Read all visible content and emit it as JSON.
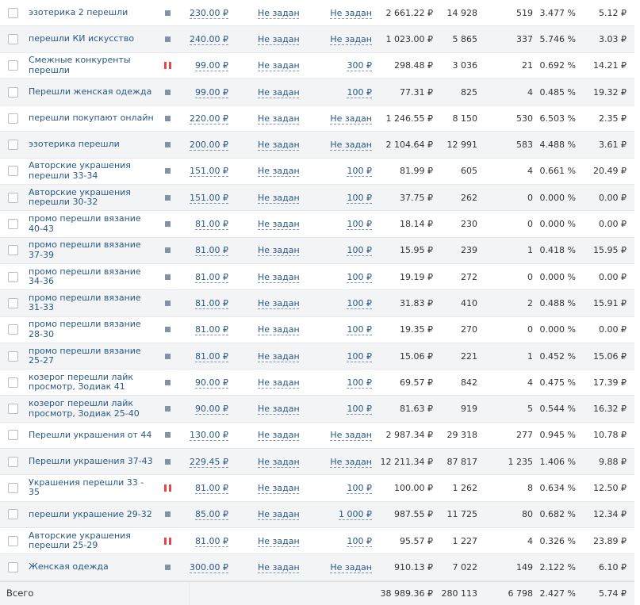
{
  "currency": "₽",
  "rows": [
    {
      "name": "эзотерика 2 перешли",
      "status": "active",
      "bid": "230.00 ₽",
      "limit_day": "Не задан",
      "limit_total": "Не задан",
      "spent": "2 661.22 ₽",
      "shows": "14 928",
      "clicks": "519",
      "ctr": "3.477 %",
      "cpc": "5.12 ₽"
    },
    {
      "name": "перешли КИ искусство",
      "status": "active",
      "bid": "240.00 ₽",
      "limit_day": "Не задан",
      "limit_total": "Не задан",
      "spent": "1 023.00 ₽",
      "shows": "5 865",
      "clicks": "337",
      "ctr": "5.746 %",
      "cpc": "3.03 ₽"
    },
    {
      "name": "Смежные конкуренты перешли",
      "status": "paused",
      "bid": "99.00 ₽",
      "limit_day": "Не задан",
      "limit_total": "300 ₽",
      "spent": "298.48 ₽",
      "shows": "3 036",
      "clicks": "21",
      "ctr": "0.692 %",
      "cpc": "14.21 ₽"
    },
    {
      "name": "Перешли женская одежда",
      "status": "active",
      "bid": "99.00 ₽",
      "limit_day": "Не задан",
      "limit_total": "100 ₽",
      "spent": "77.31 ₽",
      "shows": "825",
      "clicks": "4",
      "ctr": "0.485 %",
      "cpc": "19.32 ₽"
    },
    {
      "name": "перешли покупают онлайн",
      "status": "active",
      "bid": "220.00 ₽",
      "limit_day": "Не задан",
      "limit_total": "Не задан",
      "spent": "1 246.55 ₽",
      "shows": "8 150",
      "clicks": "530",
      "ctr": "6.503 %",
      "cpc": "2.35 ₽"
    },
    {
      "name": "эзотерика перешли",
      "status": "active",
      "bid": "200.00 ₽",
      "limit_day": "Не задан",
      "limit_total": "Не задан",
      "spent": "2 104.64 ₽",
      "shows": "12 991",
      "clicks": "583",
      "ctr": "4.488 %",
      "cpc": "3.61 ₽"
    },
    {
      "name": "Авторские украшения перешли 33-34",
      "status": "active",
      "bid": "151.00 ₽",
      "limit_day": "Не задан",
      "limit_total": "100 ₽",
      "spent": "81.99 ₽",
      "shows": "605",
      "clicks": "4",
      "ctr": "0.661 %",
      "cpc": "20.49 ₽"
    },
    {
      "name": "Авторские украшения перешли 30-32",
      "status": "active",
      "bid": "151.00 ₽",
      "limit_day": "Не задан",
      "limit_total": "100 ₽",
      "spent": "37.75 ₽",
      "shows": "262",
      "clicks": "0",
      "ctr": "0.000 %",
      "cpc": "0.00 ₽"
    },
    {
      "name": "промо перешли вязание 40-43",
      "status": "active",
      "bid": "81.00 ₽",
      "limit_day": "Не задан",
      "limit_total": "100 ₽",
      "spent": "18.14 ₽",
      "shows": "230",
      "clicks": "0",
      "ctr": "0.000 %",
      "cpc": "0.00 ₽"
    },
    {
      "name": "промо перешли вязание 37-39",
      "status": "active",
      "bid": "81.00 ₽",
      "limit_day": "Не задан",
      "limit_total": "100 ₽",
      "spent": "15.95 ₽",
      "shows": "239",
      "clicks": "1",
      "ctr": "0.418 %",
      "cpc": "15.95 ₽"
    },
    {
      "name": "промо перешли вязание 34-36",
      "status": "active",
      "bid": "81.00 ₽",
      "limit_day": "Не задан",
      "limit_total": "100 ₽",
      "spent": "19.19 ₽",
      "shows": "272",
      "clicks": "0",
      "ctr": "0.000 %",
      "cpc": "0.00 ₽"
    },
    {
      "name": "промо перешли вязание 31-33",
      "status": "active",
      "bid": "81.00 ₽",
      "limit_day": "Не задан",
      "limit_total": "100 ₽",
      "spent": "31.83 ₽",
      "shows": "410",
      "clicks": "2",
      "ctr": "0.488 %",
      "cpc": "15.91 ₽"
    },
    {
      "name": "промо перешли вязание 28-30",
      "status": "active",
      "bid": "81.00 ₽",
      "limit_day": "Не задан",
      "limit_total": "100 ₽",
      "spent": "19.35 ₽",
      "shows": "270",
      "clicks": "0",
      "ctr": "0.000 %",
      "cpc": "0.00 ₽"
    },
    {
      "name": "промо перешли вязание 25-27",
      "status": "active",
      "bid": "81.00 ₽",
      "limit_day": "Не задан",
      "limit_total": "100 ₽",
      "spent": "15.06 ₽",
      "shows": "221",
      "clicks": "1",
      "ctr": "0.452 %",
      "cpc": "15.06 ₽"
    },
    {
      "name": "козерог перешли лайк просмотр, Зодиак 41",
      "status": "active",
      "bid": "90.00 ₽",
      "limit_day": "Не задан",
      "limit_total": "100 ₽",
      "spent": "69.57 ₽",
      "shows": "842",
      "clicks": "4",
      "ctr": "0.475 %",
      "cpc": "17.39 ₽"
    },
    {
      "name": "козерог перешли лайк просмотр, Зодиак 25-40",
      "status": "active",
      "bid": "90.00 ₽",
      "limit_day": "Не задан",
      "limit_total": "100 ₽",
      "spent": "81.63 ₽",
      "shows": "919",
      "clicks": "5",
      "ctr": "0.544 %",
      "cpc": "16.32 ₽"
    },
    {
      "name": "Перешли украшения от 44",
      "status": "active",
      "bid": "130.00 ₽",
      "limit_day": "Не задан",
      "limit_total": "Не задан",
      "spent": "2 987.34 ₽",
      "shows": "29 318",
      "clicks": "277",
      "ctr": "0.945 %",
      "cpc": "10.78 ₽"
    },
    {
      "name": "Перешли украшения 37-43",
      "status": "active",
      "bid": "229.45 ₽",
      "limit_day": "Не задан",
      "limit_total": "Не задан",
      "spent": "12 211.34 ₽",
      "shows": "87 817",
      "clicks": "1 235",
      "ctr": "1.406 %",
      "cpc": "9.88 ₽"
    },
    {
      "name": "Украшения перешли 33 - 35",
      "status": "paused",
      "bid": "81.00 ₽",
      "limit_day": "Не задан",
      "limit_total": "100 ₽",
      "spent": "100.00 ₽",
      "shows": "1 262",
      "clicks": "8",
      "ctr": "0.634 %",
      "cpc": "12.50 ₽"
    },
    {
      "name": "перешли украшение 29-32",
      "status": "active",
      "bid": "85.00 ₽",
      "limit_day": "Не задан",
      "limit_total": "1 000 ₽",
      "spent": "987.55 ₽",
      "shows": "11 725",
      "clicks": "80",
      "ctr": "0.682 %",
      "cpc": "12.34 ₽"
    },
    {
      "name": "Авторские украшения перешли 25-29",
      "status": "paused",
      "bid": "81.00 ₽",
      "limit_day": "Не задан",
      "limit_total": "100 ₽",
      "spent": "95.57 ₽",
      "shows": "1 227",
      "clicks": "4",
      "ctr": "0.326 %",
      "cpc": "23.89 ₽"
    },
    {
      "name": "Женская одежда",
      "status": "active",
      "bid": "300.00 ₽",
      "limit_day": "Не задан",
      "limit_total": "Не задан",
      "spent": "910.13 ₽",
      "shows": "7 022",
      "clicks": "149",
      "ctr": "2.122 %",
      "cpc": "6.10 ₽"
    }
  ],
  "total": {
    "label": "Всего",
    "spent": "38 989.36 ₽",
    "shows": "280 113",
    "clicks": "6 798",
    "ctr": "2.427 %",
    "cpc": "5.74 ₽"
  },
  "colors": {
    "link": "#2a5885",
    "row_alt": "#f2f4f6",
    "status_active": "#8592a3",
    "status_paused": "#e64646"
  }
}
